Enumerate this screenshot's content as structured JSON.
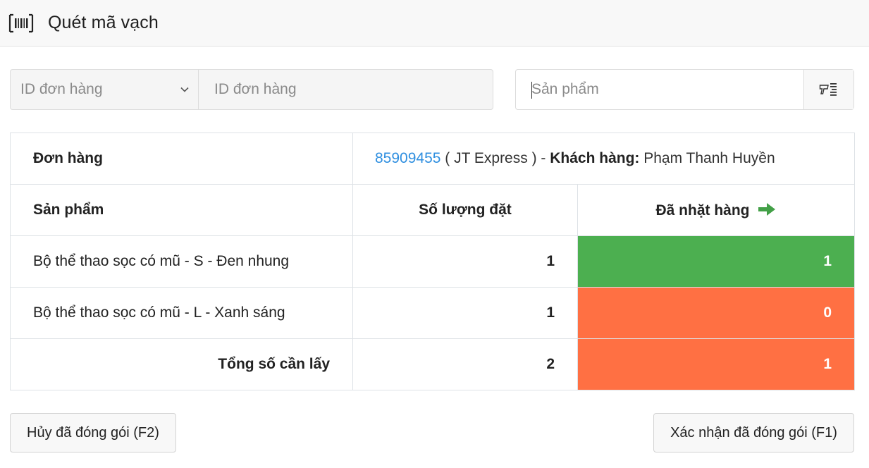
{
  "header": {
    "title": "Quét mã vạch",
    "icon": "barcode-icon"
  },
  "search": {
    "order_select_value": "ID đơn hàng",
    "order_input_placeholder": "ID đơn hàng",
    "product_input_placeholder": "Sản phẩm",
    "scan_icon": "barcode-scanner-icon"
  },
  "order": {
    "label": "Đơn hàng",
    "id": "85909455",
    "carrier_text": " ( JT Express ) - ",
    "customer_label": "Khách hàng:",
    "customer_name": " Phạm Thanh Huyền"
  },
  "table": {
    "col_product": "Sản phẩm",
    "col_ordered": "Số lượng đặt",
    "col_picked": "Đã nhặt hàng",
    "rows": [
      {
        "product": "Bộ thể thao sọc có mũ - S - Đen nhung",
        "ordered": "1",
        "picked": "1"
      },
      {
        "product": "Bộ thể thao sọc có mũ - L - Xanh sáng",
        "ordered": "1",
        "picked": "0"
      }
    ],
    "total_label": "Tổng số cần lấy",
    "total_ordered": "2",
    "total_picked": "1"
  },
  "colors": {
    "complete": "#4caf50",
    "incomplete": "#ff7043",
    "link": "#2f8fe0",
    "arrow": "#43a047"
  },
  "buttons": {
    "cancel_label": "Hủy đã đóng gói (F2)",
    "confirm_label": "Xác nhận đã đóng gói (F1)"
  }
}
